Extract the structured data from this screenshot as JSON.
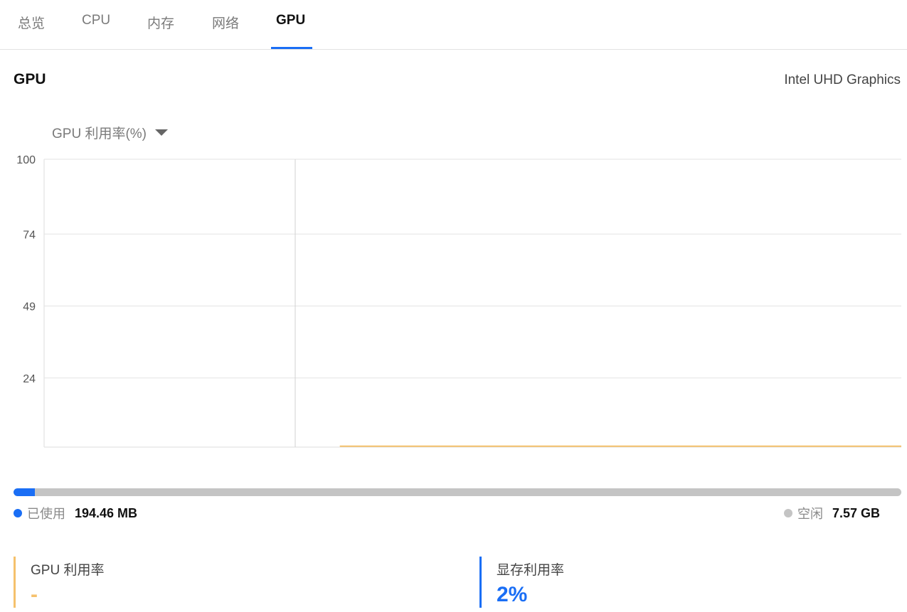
{
  "tabs": [
    {
      "label": "总览"
    },
    {
      "label": "CPU"
    },
    {
      "label": "内存"
    },
    {
      "label": "网络"
    },
    {
      "label": "GPU"
    }
  ],
  "active_tab": "GPU",
  "section": {
    "title": "GPU",
    "device_name": "Intel UHD Graphics"
  },
  "metric_select": {
    "selected": "GPU 利用率(%)"
  },
  "chart_data": {
    "type": "line",
    "ylim": [
      0,
      100
    ],
    "y_ticks": [
      "100",
      "74",
      "49",
      "24"
    ],
    "grid": true,
    "series": [
      {
        "color": "#f5c16c",
        "start_fraction": 0.345,
        "values": [
          0.3,
          0.3,
          0.3,
          0.3,
          0.3,
          0.3,
          0.3,
          0.3,
          0.3,
          0.3
        ]
      }
    ]
  },
  "memory": {
    "used_label": "已使用",
    "used_value": "194.46 MB",
    "free_label": "空闲",
    "free_value": "7.57 GB",
    "used_fraction": 0.024,
    "used_color": "#1a6ef5",
    "free_color": "#c4c4c4"
  },
  "stats": {
    "gpu_usage": {
      "label": "GPU 利用率",
      "value": "-",
      "color": "#f5c16c"
    },
    "vram_usage": {
      "label": "显存利用率",
      "value": "2%",
      "color": "#1a6ef5"
    }
  }
}
